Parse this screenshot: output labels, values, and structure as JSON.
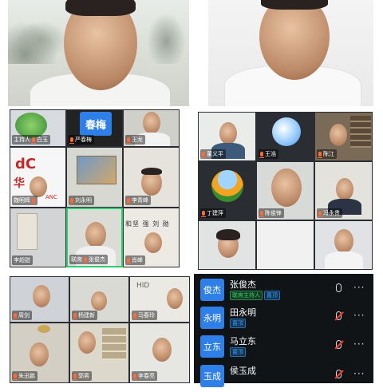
{
  "top_videos": {
    "left_desc": "man-in-white-shirt-landscape-background",
    "right_desc": "man-in-white-shirt-white-background"
  },
  "grid_left": {
    "tiles": [
      {
        "name": "主持人",
        "icon": "mic-icon"
      },
      {
        "name": "白玉",
        "icon": "mic-icon"
      },
      {
        "name": "严春梅",
        "avatar_text": "春梅",
        "icon": "mic-icon"
      },
      {
        "name": "王龙",
        "icon": "mic-icon"
      },
      {
        "name": "魏明辉",
        "logo_text": "华",
        "logo_sub": "ANC",
        "icon": "mic-icon"
      },
      {
        "name": "刘永明",
        "icon": "mic-icon"
      },
      {
        "name": "李青峰",
        "icon": "mic-icon"
      },
      {
        "name": "李超甜",
        "icon": "mic-icon"
      },
      {
        "name": "张俊杰",
        "prefix": "联席",
        "icon": "mic-icon"
      },
      {
        "name": "肖峰",
        "icon": "mic-icon",
        "banner": "和坚 强 刘 勋"
      }
    ]
  },
  "grid_right": {
    "tiles": [
      {
        "name": "董义平",
        "icon": "mic-icon"
      },
      {
        "name": "王浩",
        "icon": "mic-icon"
      },
      {
        "name": "陈江",
        "icon": "mic-icon"
      },
      {
        "name": "丁建萍",
        "icon": "mic-icon"
      },
      {
        "name": "陈俊锋",
        "icon": "mic-icon"
      },
      {
        "name": "冯永贵",
        "icon": "mic-icon"
      },
      {
        "name": "",
        "icon": ""
      },
      {
        "name": "",
        "icon": ""
      },
      {
        "name": "",
        "icon": ""
      }
    ]
  },
  "grid_bottom": {
    "tiles": [
      {
        "name": "周剑",
        "icon": "mic-icon"
      },
      {
        "name": "杨建新",
        "icon": "mic-icon"
      },
      {
        "name": "马春玲",
        "icon": "mic-icon",
        "wall_text": "HID"
      },
      {
        "name": "朱迅鹏",
        "icon": "mic-icon"
      },
      {
        "name": "郭蓉",
        "icon": "mic-icon"
      },
      {
        "name": "李春亮",
        "icon": "mic-icon"
      }
    ]
  },
  "participants": [
    {
      "avatar": "俊杰",
      "name": "张俊杰",
      "tags": [
        {
          "text": "联席主持人",
          "style": "green"
        },
        {
          "text": "置顶",
          "style": "blue"
        }
      ],
      "mic": "on"
    },
    {
      "avatar": "永明",
      "name": "田永明",
      "tags": [
        {
          "text": "置顶",
          "style": "blue"
        }
      ],
      "mic": "off"
    },
    {
      "avatar": "立东",
      "name": "马立东",
      "tags": [
        {
          "text": "置顶",
          "style": "blue"
        }
      ],
      "mic": "off"
    },
    {
      "avatar": "玉成",
      "name": "侯玉成",
      "tags": [],
      "mic": "off"
    }
  ],
  "more_label": "···"
}
